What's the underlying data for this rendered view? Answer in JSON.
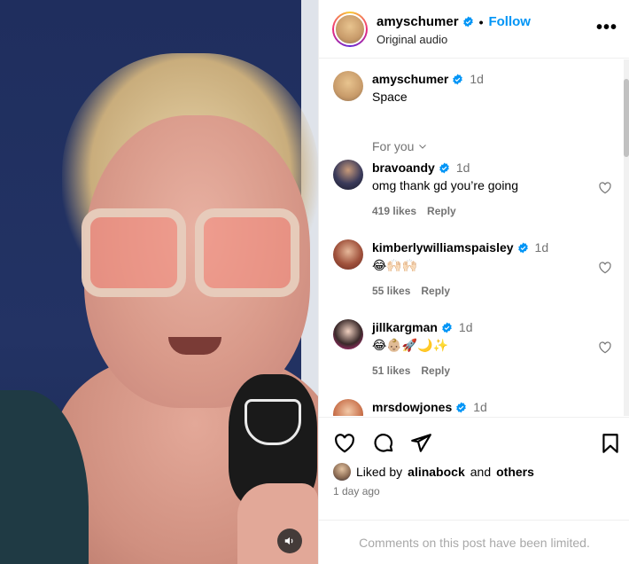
{
  "post": {
    "username": "amyschumer",
    "follow_label": "Follow",
    "separator": "•",
    "subtitle": "Original audio",
    "more_label": "•••"
  },
  "caption": {
    "username": "amyschumer",
    "time": "1d",
    "text": "Space"
  },
  "for_you_label": "For you",
  "comments": [
    {
      "username": "bravoandy",
      "time": "1d",
      "text": "omg thank gd you’re going",
      "likes": "419 likes",
      "reply": "Reply"
    },
    {
      "username": "kimberlywilliamspaisley",
      "time": "1d",
      "text": "😂🙌🏻🙌🏻",
      "likes": "55 likes",
      "reply": "Reply"
    },
    {
      "username": "jillkargman",
      "time": "1d",
      "text": "😂👶🏼🚀🌙✨",
      "likes": "51 likes",
      "reply": "Reply"
    },
    {
      "username": "mrsdowjones",
      "time": "1d",
      "text": "",
      "likes": "",
      "reply": ""
    }
  ],
  "liked_by": {
    "prefix": "Liked by",
    "user": "alinabock",
    "conj": "and",
    "others": "others"
  },
  "time_ago": "1 day ago",
  "comments_limited": "Comments on this post have been limited.",
  "colors": {
    "follow": "#0095f6",
    "verified": "#0095f6",
    "muted": "#737373"
  },
  "icons": [
    "verified-icon",
    "more-icon",
    "chevron-down-icon",
    "heart-icon",
    "like-icon",
    "comment-icon",
    "share-icon",
    "bookmark-icon",
    "audio-icon"
  ]
}
